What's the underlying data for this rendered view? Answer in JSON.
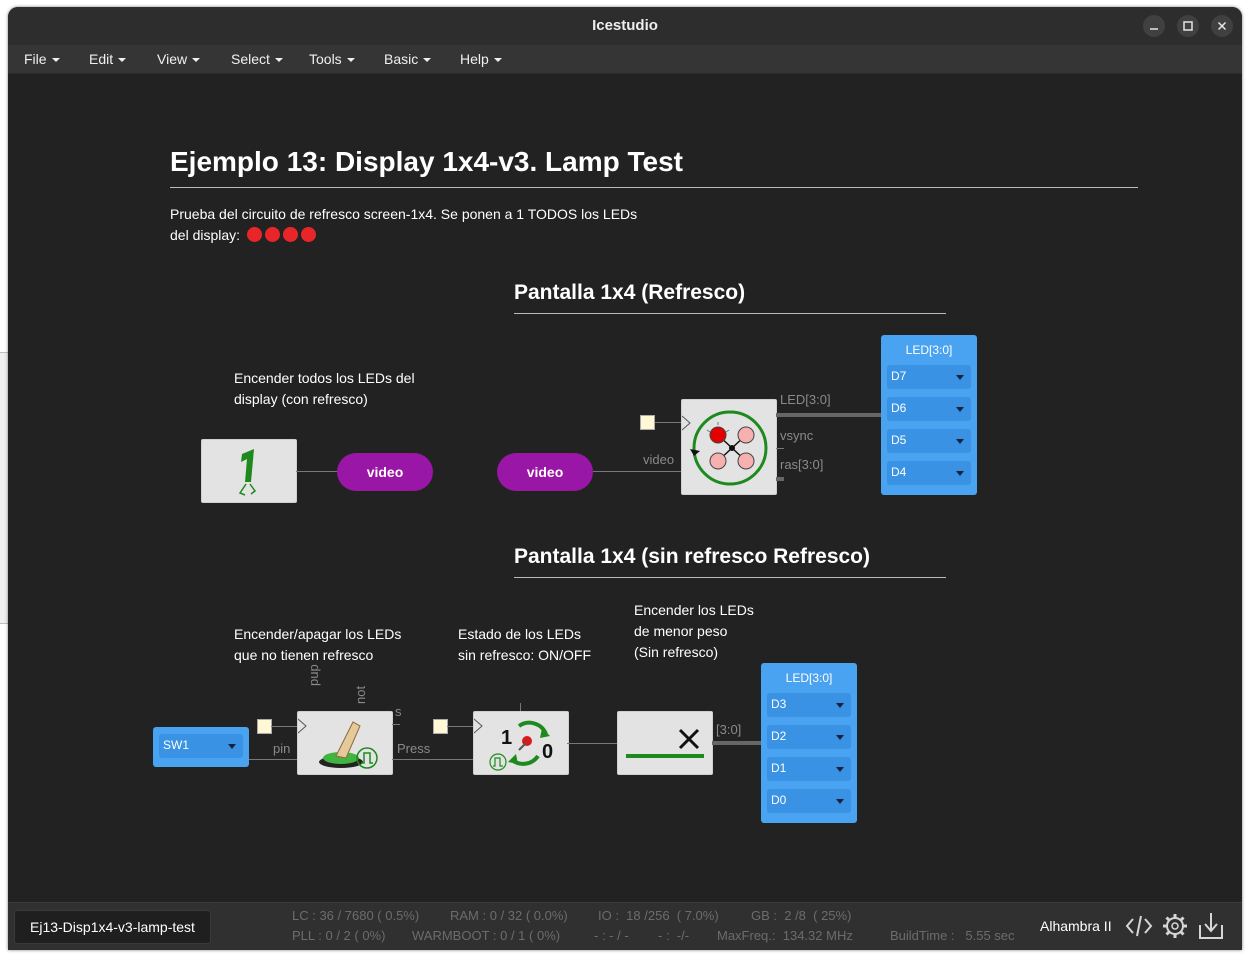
{
  "window": {
    "title": "Icestudio"
  },
  "menu": [
    "File",
    "Edit",
    "View",
    "Select",
    "Tools",
    "Basic",
    "Help"
  ],
  "doc": {
    "title": "Ejemplo 13: Display 1x4-v3. Lamp Test",
    "desc_line1": "Prueba del circuito de refresco screen-1x4. Se ponen a 1 TODOS los LEDs",
    "desc_line2": "del display:",
    "section1": "Pantalla 1x4 (Refresco)",
    "section2": "Pantalla 1x4 (sin refresco Refresco)",
    "note1_l1": "Encender todos los LEDs del",
    "note1_l2": "display (con refresco)",
    "note2_l1": "Encender/apagar los LEDs",
    "note2_l2": "que no tienen refresco",
    "note3_l1": "Estado de los LEDs",
    "note3_l2": "sin refresco: ON/OFF",
    "note4_l1": "Encender los LEDs",
    "note4_l2": "de menor peso",
    "note4_l3": "(Sin refresco)"
  },
  "circuit": {
    "video_label_out": "video",
    "video_label_in": "video",
    "port_video": "video",
    "port_led": "LED[3:0]",
    "port_vsync": "vsync",
    "port_ras": "ras[3:0]",
    "port_pup": "pup",
    "port_not": "not",
    "port_s": "s",
    "port_pin": "pin",
    "port_press": "Press",
    "port_bus": "[3:0]",
    "const_one": "1",
    "toggle_one": "1",
    "toggle_zero": "0",
    "led_panel_top": {
      "title": "LED[3:0]",
      "pins": [
        "D7",
        "D6",
        "D5",
        "D4"
      ]
    },
    "led_panel_bottom": {
      "title": "LED[3:0]",
      "pins": [
        "D3",
        "D2",
        "D1",
        "D0"
      ]
    },
    "sw_input": "SW1"
  },
  "status": {
    "filename": "Ej13-Disp1x4-v3-lamp-test",
    "lc": "LC : 36 / 7680 ( 0.5%)",
    "ram": "RAM : 0 / 32 ( 0.0%)",
    "io": "IO :  18 /256  ( 7.0%)",
    "gb": "GB :  2 /8  ( 25%)",
    "pll": "PLL : 0 / 2 ( 0%)",
    "warmboot": "WARMBOOT : 0 / 1 ( 0%)",
    "blank1": "- : - / -",
    "blank2": "- :  -/-",
    "maxfreq": "MaxFreq.:  134.32 MHz",
    "buildtime": "BuildTime :   5.55 sec",
    "board": "Alhambra II"
  }
}
